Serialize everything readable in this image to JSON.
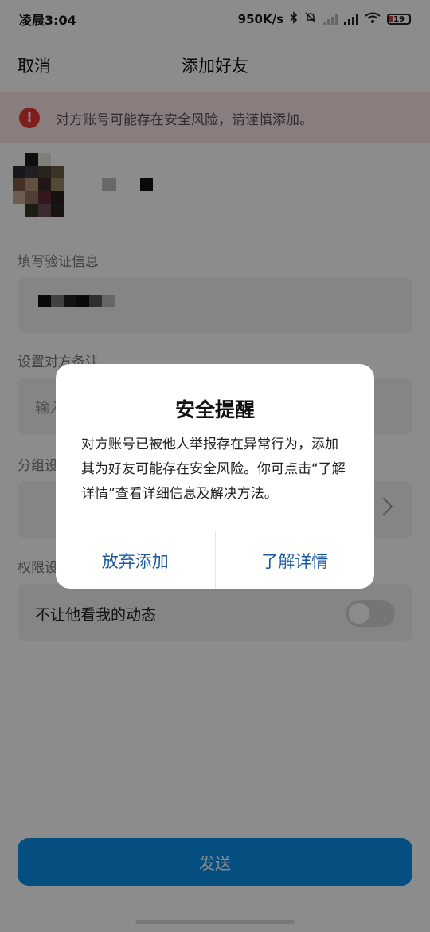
{
  "status_bar": {
    "time": "凌晨3:04",
    "speed": "950K/s",
    "battery": "19"
  },
  "nav": {
    "cancel": "取消",
    "title": "添加好友"
  },
  "warning": {
    "icon": "!",
    "text": "对方账号可能存在安全风险，请谨慎添加。"
  },
  "form": {
    "verify_label": "填写验证信息",
    "remark_label": "设置对方备注",
    "remark_placeholder": "输入",
    "group_label": "分组设",
    "permission_label": "权限设",
    "permission_item": "不让他看我的动态",
    "send_button": "发送"
  },
  "dialog": {
    "title": "安全提醒",
    "message": "对方账号已被他人举报存在异常行为，添加其为好友可能存在安全风险。你可点击“了解详情”查看详细信息及解决方法。",
    "cancel_button": "放弃添加",
    "confirm_button": "了解详情"
  },
  "colors": {
    "accent": "#0a8fea",
    "warning": "#e53935",
    "dialog_link": "#1d5a9e"
  },
  "icons": [
    "bluetooth-icon",
    "mute-bell-icon",
    "signal-icon",
    "wifi-icon",
    "battery-icon",
    "warning-icon",
    "chevron-right-icon"
  ]
}
